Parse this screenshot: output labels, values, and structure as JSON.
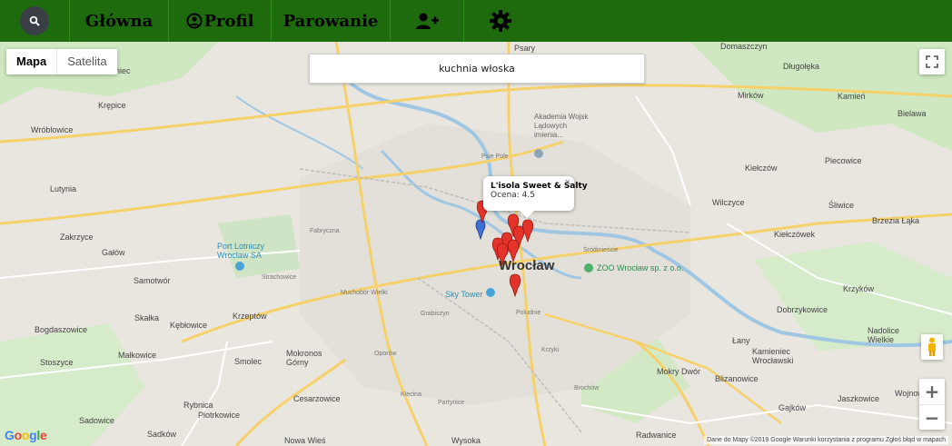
{
  "nav": {
    "items": [
      {
        "label": "Główna"
      },
      {
        "label": "Profil"
      },
      {
        "label": "Parowanie"
      }
    ]
  },
  "map": {
    "type_buttons": [
      {
        "label": "Mapa"
      },
      {
        "label": "Satelita"
      }
    ],
    "search_value": "kuchnia włoska",
    "info_window": {
      "title": "L'isola Sweet & Salty",
      "rating": "Ocena: 4.5"
    },
    "city": "Wrocław",
    "attribution": "Dane do Mapy ©2019 Google   Warunki korzystania z programu   Zgłoś błąd w mapach",
    "google_logo": "Google",
    "places": [
      "Psary",
      "Domaszczyn",
      "Długołęka",
      "Kamień",
      "Bielawa",
      "Mirków",
      "Krępice",
      "Żurawiniec",
      "Wróblowice",
      "Akademia Wojsk Lądowych imienia...",
      "Kiełczów",
      "Piecowice",
      "Wilczyce",
      "Śliwice",
      "Brzezia Łąka",
      "Kiełczówek",
      "Lutynia",
      "Zakrzyce",
      "Gałów",
      "Port Lotniczy Wrocław SA",
      "ZOO Wrocław sp. z o.o.",
      "Samotwór",
      "Sky Tower",
      "Krzyków",
      "Skałka",
      "Kębłowice",
      "Krzeptów",
      "Dobrzykowice",
      "Bogdaszowice",
      "Nadolice Wielkie",
      "Łany",
      "Małkowice",
      "Smolec",
      "Mokronos Górny",
      "Kamieniec Wrocławski",
      "Stoszyce",
      "Mokry Dwór",
      "Blizanowice",
      "Cesarzowice",
      "Rybnica",
      "Gajków",
      "Jaszkowice",
      "Wojnow",
      "Piotrkowice",
      "Sadowice",
      "Sadków",
      "Nowa Wieś",
      "Wysoka",
      "Radwanice",
      "Fabryczna",
      "Strachowice",
      "Muchobór Wielki",
      "Grabiszyn",
      "Poludnie",
      "Krzyki",
      "Oporów",
      "Klecina",
      "Partynice",
      "Brochów",
      "Śródmieście",
      "Psie Pole"
    ]
  }
}
